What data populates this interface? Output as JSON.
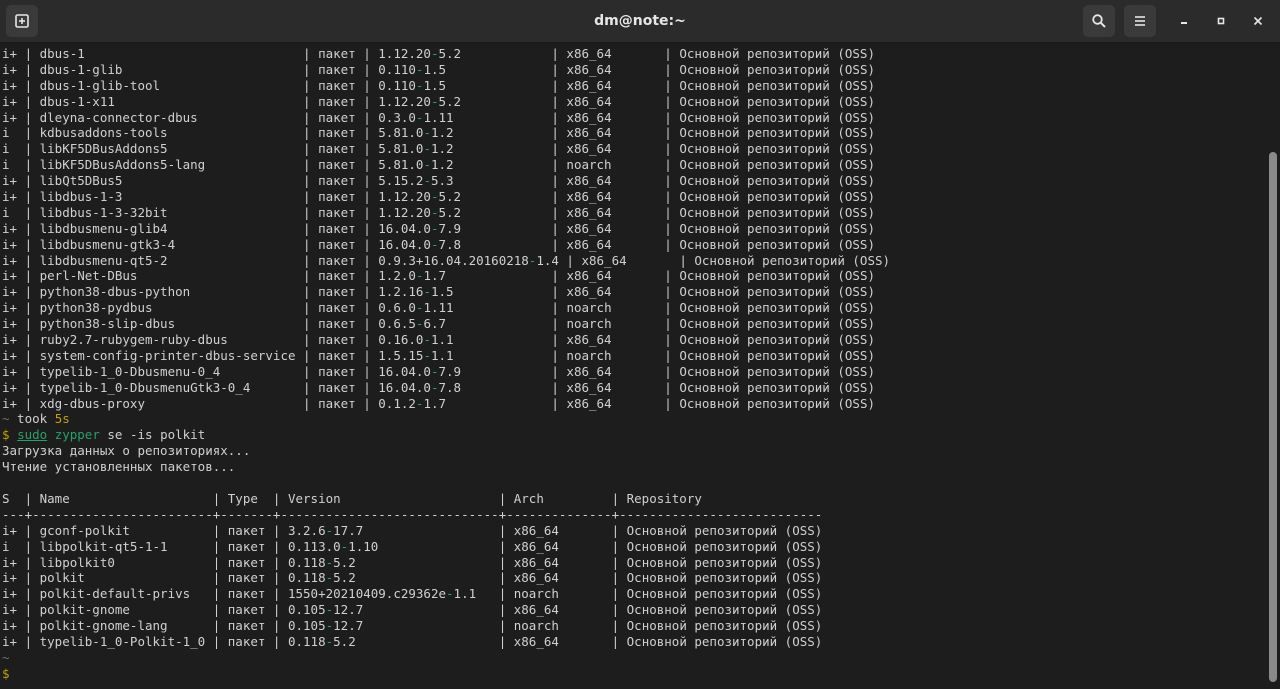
{
  "window": {
    "title": "dm@note:~"
  },
  "icons": {
    "new_tab": "new-tab-icon",
    "search": "search-icon",
    "menu": "hamburger-menu-icon",
    "minimize": "minimize-icon",
    "maximize": "maximize-icon",
    "close": "close-icon"
  },
  "colors": {
    "background": "#1d1d1d",
    "headerbar": "#2b2b2b",
    "text": "#d0d0d0",
    "green": "#26a269",
    "yellow": "#c4a000"
  },
  "terminal": {
    "dbus_rows": [
      [
        "i+",
        "dbus-1",
        "пакет",
        "1.12.20",
        "5.2",
        "x86_64",
        "Основной репозиторий (OSS)"
      ],
      [
        "i+",
        "dbus-1-glib",
        "пакет",
        "0.110",
        "1.5",
        "x86_64",
        "Основной репозиторий (OSS)"
      ],
      [
        "i+",
        "dbus-1-glib-tool",
        "пакет",
        "0.110",
        "1.5",
        "x86_64",
        "Основной репозиторий (OSS)"
      ],
      [
        "i+",
        "dbus-1-x11",
        "пакет",
        "1.12.20",
        "5.2",
        "x86_64",
        "Основной репозиторий (OSS)"
      ],
      [
        "i+",
        "dleyna-connector-dbus",
        "пакет",
        "0.3.0",
        "1.11",
        "x86_64",
        "Основной репозиторий (OSS)"
      ],
      [
        "i",
        "kdbusaddons-tools",
        "пакет",
        "5.81.0",
        "1.2",
        "x86_64",
        "Основной репозиторий (OSS)"
      ],
      [
        "i",
        "libKF5DBusAddons5",
        "пакет",
        "5.81.0",
        "1.2",
        "x86_64",
        "Основной репозиторий (OSS)"
      ],
      [
        "i",
        "libKF5DBusAddons5-lang",
        "пакет",
        "5.81.0",
        "1.2",
        "noarch",
        "Основной репозиторий (OSS)"
      ],
      [
        "i+",
        "libQt5DBus5",
        "пакет",
        "5.15.2",
        "5.3",
        "x86_64",
        "Основной репозиторий (OSS)"
      ],
      [
        "i+",
        "libdbus-1-3",
        "пакет",
        "1.12.20",
        "5.2",
        "x86_64",
        "Основной репозиторий (OSS)"
      ],
      [
        "i",
        "libdbus-1-3-32bit",
        "пакет",
        "1.12.20",
        "5.2",
        "x86_64",
        "Основной репозиторий (OSS)"
      ],
      [
        "i+",
        "libdbusmenu-glib4",
        "пакет",
        "16.04.0",
        "7.9",
        "x86_64",
        "Основной репозиторий (OSS)"
      ],
      [
        "i+",
        "libdbusmenu-gtk3-4",
        "пакет",
        "16.04.0",
        "7.8",
        "x86_64",
        "Основной репозиторий (OSS)"
      ],
      [
        "i+",
        "libdbusmenu-qt5-2",
        "пакет",
        "0.9.3+16.04.20160218",
        "1.4",
        "x86_64",
        "Основной репозиторий (OSS)"
      ],
      [
        "i+",
        "perl-Net-DBus",
        "пакет",
        "1.2.0",
        "1.7",
        "x86_64",
        "Основной репозиторий (OSS)"
      ],
      [
        "i+",
        "python38-dbus-python",
        "пакет",
        "1.2.16",
        "1.5",
        "x86_64",
        "Основной репозиторий (OSS)"
      ],
      [
        "i+",
        "python38-pydbus",
        "пакет",
        "0.6.0",
        "1.11",
        "noarch",
        "Основной репозиторий (OSS)"
      ],
      [
        "i+",
        "python38-slip-dbus",
        "пакет",
        "0.6.5",
        "6.7",
        "noarch",
        "Основной репозиторий (OSS)"
      ],
      [
        "i+",
        "ruby2.7-rubygem-ruby-dbus",
        "пакет",
        "0.16.0",
        "1.1",
        "x86_64",
        "Основной репозиторий (OSS)"
      ],
      [
        "i+",
        "system-config-printer-dbus-service",
        "пакет",
        "1.5.15",
        "1.1",
        "noarch",
        "Основной репозиторий (OSS)"
      ],
      [
        "i+",
        "typelib-1_0-Dbusmenu-0_4",
        "пакет",
        "16.04.0",
        "7.9",
        "x86_64",
        "Основной репозиторий (OSS)"
      ],
      [
        "i+",
        "typelib-1_0-DbusmenuGtk3-0_4",
        "пакет",
        "16.04.0",
        "7.8",
        "x86_64",
        "Основной репозиторий (OSS)"
      ],
      [
        "i+",
        "xdg-dbus-proxy",
        "пакет",
        "0.1.2",
        "1.7",
        "x86_64",
        "Основной репозиторий (OSS)"
      ]
    ],
    "took_line": {
      "tilde": "~",
      "took_label": "took",
      "took_time": "5s"
    },
    "command_line": {
      "dollar": "$",
      "sudo": "sudo",
      "zypper": "zypper",
      "args": "se -is polkit"
    },
    "status_lines": [
      "Загрузка данных о репозиториях...",
      "Чтение установленных пакетов..."
    ],
    "polkit_headers": [
      "S",
      "Name",
      "Type",
      "Version",
      "Arch",
      "Repository"
    ],
    "polkit_rows": [
      [
        "i+",
        "gconf-polkit",
        "пакет",
        "3.2.6",
        "17.7",
        "x86_64",
        "Основной репозиторий (OSS)"
      ],
      [
        "i",
        "libpolkit-qt5-1-1",
        "пакет",
        "0.113.0",
        "1.10",
        "x86_64",
        "Основной репозиторий (OSS)"
      ],
      [
        "i+",
        "libpolkit0",
        "пакет",
        "0.118",
        "5.2",
        "x86_64",
        "Основной репозиторий (OSS)"
      ],
      [
        "i+",
        "polkit",
        "пакет",
        "0.118",
        "5.2",
        "x86_64",
        "Основной репозиторий (OSS)"
      ],
      [
        "i+",
        "polkit-default-privs",
        "пакет",
        "1550+20210409.c29362e",
        "1.1",
        "noarch",
        "Основной репозиторий (OSS)"
      ],
      [
        "i+",
        "polkit-gnome",
        "пакет",
        "0.105",
        "12.7",
        "x86_64",
        "Основной репозиторий (OSS)"
      ],
      [
        "i+",
        "polkit-gnome-lang",
        "пакет",
        "0.105",
        "12.7",
        "noarch",
        "Основной репозиторий (OSS)"
      ],
      [
        "i+",
        "typelib-1_0-Polkit-1_0",
        "пакет",
        "0.118",
        "5.2",
        "x86_64",
        "Основной репозиторий (OSS)"
      ]
    ],
    "final_prompt": {
      "tilde": "~",
      "dollar": "$"
    }
  }
}
